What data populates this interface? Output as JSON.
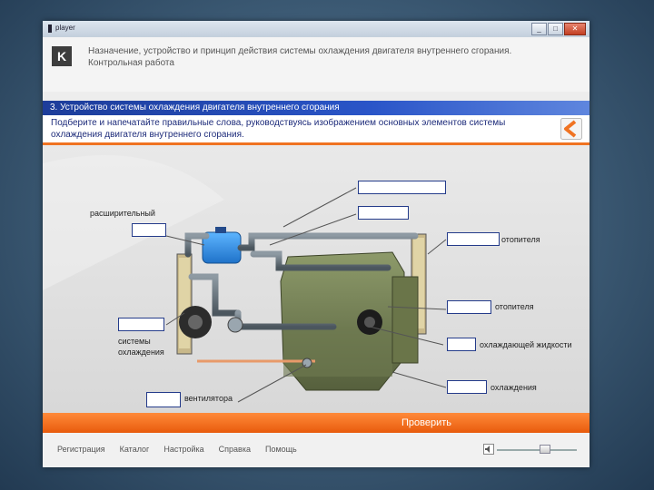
{
  "window": {
    "title": "player",
    "controls": [
      "minimize-icon",
      "maximize-icon",
      "close-icon"
    ]
  },
  "header": {
    "logo_text": "K",
    "title": "Назначение, устройство и принцип действия системы охлаждения двигателя внутреннего сгорания. Контрольная работа"
  },
  "section": {
    "title": "3. Устройство системы охлаждения двигателя внутреннего сгорания",
    "instruction": "Подберите и напечатайте правильные слова, руководствуясь изображением основных элементов системы охлаждения двигателя внутреннего сгорания.",
    "back_icon": "chevron-left-icon"
  },
  "diagram": {
    "labels": {
      "expansion": "расширительный",
      "heater_1": "отопителя",
      "heater_2": "отопителя",
      "coolant": "охлаждающей жидкости",
      "cooling": "охлаждения",
      "system_1": "системы",
      "system_2": "охлаждения",
      "fan": "вентилятора"
    },
    "inputs": {
      "top_1": "",
      "top_2": "",
      "expansion": "",
      "heater_1": "",
      "heater_2": "",
      "coolant": "",
      "cooling": "",
      "system": "",
      "fan": ""
    }
  },
  "actions": {
    "check": "Проверить"
  },
  "footer": {
    "nav": [
      "Регистрация",
      "Каталог",
      "Настройка",
      "Справка",
      "Помощь"
    ],
    "volume_icon": "speaker-icon",
    "volume_level": 0.6
  },
  "colors": {
    "accent": "#f07322",
    "primary": "#2a55c8",
    "box_border": "#243b8a"
  }
}
